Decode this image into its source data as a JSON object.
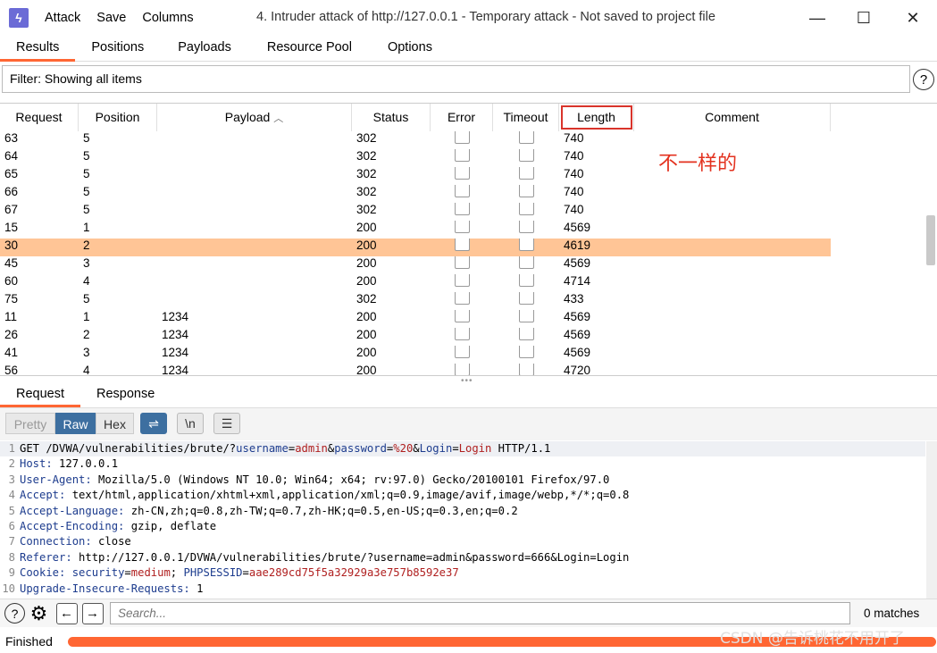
{
  "menu": {
    "attack": "Attack",
    "save": "Save",
    "columns": "Columns"
  },
  "window": {
    "title": "4. Intruder attack of http://127.0.0.1 - Temporary attack - Not saved to project file"
  },
  "tabs": [
    "Results",
    "Positions",
    "Payloads",
    "Resource Pool",
    "Options"
  ],
  "filter": {
    "text": "Filter: Showing all items"
  },
  "table": {
    "headers": {
      "request": "Request",
      "position": "Position",
      "payload": "Payload",
      "sort_indicator": "^",
      "status": "Status",
      "error": "Error",
      "timeout": "Timeout",
      "length": "Length",
      "comment": "Comment"
    },
    "rows": [
      {
        "request": "63",
        "position": "5",
        "payload": "",
        "status": "302",
        "length": "740"
      },
      {
        "request": "64",
        "position": "5",
        "payload": "",
        "status": "302",
        "length": "740"
      },
      {
        "request": "65",
        "position": "5",
        "payload": "",
        "status": "302",
        "length": "740"
      },
      {
        "request": "66",
        "position": "5",
        "payload": "",
        "status": "302",
        "length": "740"
      },
      {
        "request": "67",
        "position": "5",
        "payload": "",
        "status": "302",
        "length": "740"
      },
      {
        "request": "15",
        "position": "1",
        "payload": "",
        "status": "200",
        "length": "4569"
      },
      {
        "request": "30",
        "position": "2",
        "payload": "",
        "status": "200",
        "length": "4619"
      },
      {
        "request": "45",
        "position": "3",
        "payload": "",
        "status": "200",
        "length": "4569"
      },
      {
        "request": "60",
        "position": "4",
        "payload": "",
        "status": "200",
        "length": "4714"
      },
      {
        "request": "75",
        "position": "5",
        "payload": "",
        "status": "302",
        "length": "433"
      },
      {
        "request": "11",
        "position": "1",
        "payload": "1234",
        "status": "200",
        "length": "4569"
      },
      {
        "request": "26",
        "position": "2",
        "payload": "1234",
        "status": "200",
        "length": "4569"
      },
      {
        "request": "41",
        "position": "3",
        "payload": "1234",
        "status": "200",
        "length": "4569"
      },
      {
        "request": "56",
        "position": "4",
        "payload": "1234",
        "status": "200",
        "length": "4720"
      }
    ],
    "selected_index": 6,
    "annotation": "不一样的"
  },
  "sub_tabs": [
    "Request",
    "Response"
  ],
  "toolbar": {
    "pretty": "Pretty",
    "raw": "Raw",
    "hex": "Hex",
    "newline_label": "\\n"
  },
  "editor": {
    "lines": [
      {
        "n": "1",
        "parts": [
          [
            "t",
            "GET /DVWA/vulnerabilities/brute/?"
          ],
          [
            "k",
            "username"
          ],
          [
            "t",
            "="
          ],
          [
            "v",
            "admin"
          ],
          [
            "t",
            "&"
          ],
          [
            "k",
            "password"
          ],
          [
            "t",
            "="
          ],
          [
            "v",
            "%20"
          ],
          [
            "t",
            "&"
          ],
          [
            "k",
            "Login"
          ],
          [
            "t",
            "="
          ],
          [
            "v",
            "Login"
          ],
          [
            "t",
            " HTTP/1.1"
          ]
        ]
      },
      {
        "n": "2",
        "parts": [
          [
            "k",
            "Host:"
          ],
          [
            "t",
            " 127.0.0.1"
          ]
        ]
      },
      {
        "n": "3",
        "parts": [
          [
            "k",
            "User-Agent:"
          ],
          [
            "t",
            " Mozilla/5.0 (Windows NT 10.0; Win64; x64; rv:97.0) Gecko/20100101 Firefox/97.0"
          ]
        ]
      },
      {
        "n": "4",
        "parts": [
          [
            "k",
            "Accept:"
          ],
          [
            "t",
            " text/html,application/xhtml+xml,application/xml;q=0.9,image/avif,image/webp,*/*;q=0.8"
          ]
        ]
      },
      {
        "n": "5",
        "parts": [
          [
            "k",
            "Accept-Language:"
          ],
          [
            "t",
            " zh-CN,zh;q=0.8,zh-TW;q=0.7,zh-HK;q=0.5,en-US;q=0.3,en;q=0.2"
          ]
        ]
      },
      {
        "n": "6",
        "parts": [
          [
            "k",
            "Accept-Encoding:"
          ],
          [
            "t",
            " gzip, deflate"
          ]
        ]
      },
      {
        "n": "7",
        "parts": [
          [
            "k",
            "Connection:"
          ],
          [
            "t",
            " close"
          ]
        ]
      },
      {
        "n": "8",
        "parts": [
          [
            "k",
            "Referer:"
          ],
          [
            "t",
            " http://127.0.0.1/DVWA/vulnerabilities/brute/?username=admin&password=666&Login=Login"
          ]
        ]
      },
      {
        "n": "9",
        "parts": [
          [
            "k",
            "Cookie:"
          ],
          [
            "t",
            " "
          ],
          [
            "k",
            "security"
          ],
          [
            "t",
            "="
          ],
          [
            "v",
            "medium"
          ],
          [
            "t",
            "; "
          ],
          [
            "k",
            "PHPSESSID"
          ],
          [
            "t",
            "="
          ],
          [
            "v",
            "aae289cd75f5a32929a3e757b8592e37"
          ]
        ]
      },
      {
        "n": "10",
        "parts": [
          [
            "k",
            "Upgrade-Insecure-Requests:"
          ],
          [
            "t",
            " 1"
          ]
        ]
      }
    ]
  },
  "search": {
    "placeholder": "Search...",
    "matches": "0 matches"
  },
  "status": {
    "text": "Finished",
    "progress": 1.0
  },
  "watermark": "CSDN @告诉桃花不用开了",
  "colors": {
    "accent": "#ff6633",
    "selected_row": "#ffc596",
    "annotation": "#e3321f",
    "raw_active": "#3d6fa0"
  },
  "icons": {
    "app": "burp-lightning-icon",
    "help": "help-icon",
    "settings": "gear-icon",
    "back": "arrow-left-icon",
    "forward": "arrow-right-icon"
  }
}
